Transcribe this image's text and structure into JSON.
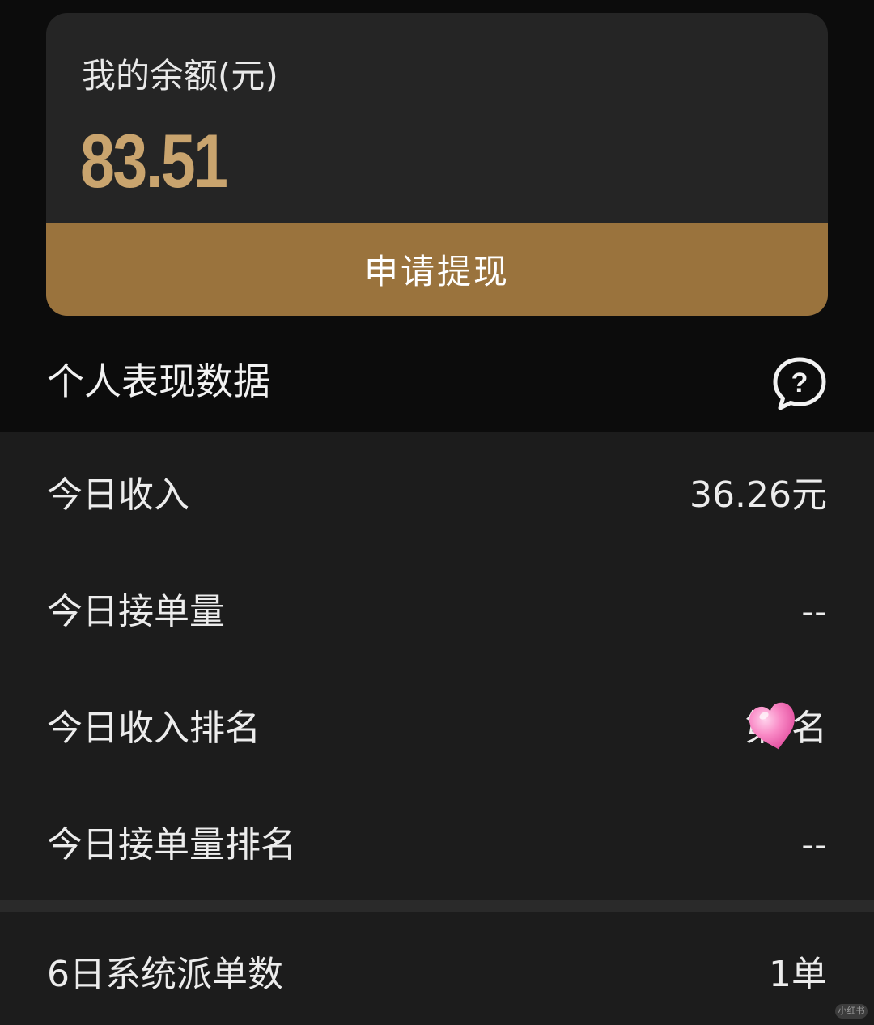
{
  "balance": {
    "label": "我的余额(元)",
    "amount": "83.51",
    "withdraw_label": "申请提现",
    "accent_color": "#c9a46e",
    "button_color": "#9a733d"
  },
  "performance": {
    "title": "个人表现数据",
    "help_icon": "question-bubble-icon"
  },
  "stats": [
    {
      "label": "今日收入",
      "value": "36.26元"
    },
    {
      "label": "今日接单量",
      "value": "--"
    },
    {
      "label": "今日收入排名",
      "value": "第 名"
    },
    {
      "label": "今日接单量排名",
      "value": "--"
    }
  ],
  "stats_extra": [
    {
      "label": "6日系统派单数",
      "value": "1单"
    }
  ],
  "watermark": {
    "text": "小红书"
  }
}
